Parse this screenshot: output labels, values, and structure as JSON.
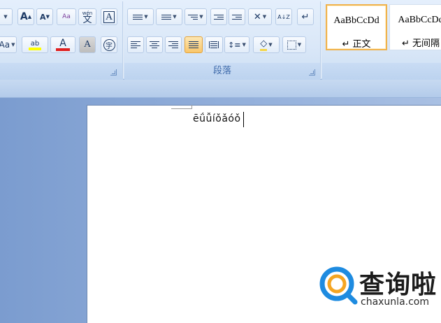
{
  "ribbon": {
    "font_group": {
      "grow_font_glyph": "A",
      "shrink_font_glyph": "A",
      "clear_format_glyph": "Aa",
      "phonetic_label": "wén",
      "phonetic_glyph": "文",
      "char_border_glyph": "A",
      "change_case_glyph": "Aa",
      "highlight_glyph": "ab",
      "font_color_glyph": "A",
      "char_shading_glyph": "A",
      "enclose_char_glyph": "字",
      "highlight_color": "#ffff00",
      "font_color": "#e02020"
    },
    "paragraph_group": {
      "label": "段落",
      "sort_glyph": "A↓Z"
    },
    "styles_group": {
      "styles": [
        {
          "sample": "AaBbCcDd",
          "name": "↵ 正文",
          "selected": true
        },
        {
          "sample": "AaBbCcDd",
          "name": "↵ 无间隔",
          "selected": false
        }
      ]
    }
  },
  "document": {
    "text": "ēǘǚíǒǎóǒ"
  },
  "watermark": {
    "title": "查询啦",
    "url": "chaxunla.com",
    "accent_color": "#1e8be0",
    "accent_color_2": "#f4a522"
  }
}
